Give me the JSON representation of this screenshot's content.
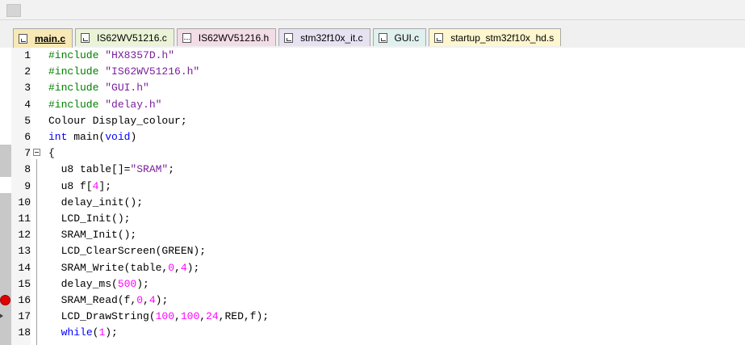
{
  "tabs": [
    {
      "label": "main.c",
      "bg": "#f7e8b5",
      "active": true,
      "icon": "c-file-icon"
    },
    {
      "label": "IS62WV51216.c",
      "bg": "#eaf3d6",
      "active": false,
      "icon": "c-file-icon"
    },
    {
      "label": "IS62WV51216.h",
      "bg": "#f2dce6",
      "active": false,
      "icon": "h-file-icon"
    },
    {
      "label": "stm32f10x_it.c",
      "bg": "#e6e2f2",
      "active": false,
      "icon": "c-file-icon"
    },
    {
      "label": "GUI.c",
      "bg": "#dff0ee",
      "active": false,
      "icon": "c-file-icon"
    },
    {
      "label": "startup_stm32f10x_hd.s",
      "bg": "#fdf6cf",
      "active": false,
      "icon": "s-file-icon"
    }
  ],
  "lines": [
    {
      "n": "1",
      "parts": [
        [
          "pp",
          "#include "
        ],
        [
          "str",
          "\"HX8357D.h\""
        ]
      ]
    },
    {
      "n": "2",
      "parts": [
        [
          "pp",
          "#include "
        ],
        [
          "str",
          "\"IS62WV51216.h\""
        ]
      ]
    },
    {
      "n": "3",
      "parts": [
        [
          "pp",
          "#include "
        ],
        [
          "str",
          "\"GUI.h\""
        ]
      ]
    },
    {
      "n": "4",
      "parts": [
        [
          "pp",
          "#include "
        ],
        [
          "str",
          "\"delay.h\""
        ]
      ]
    },
    {
      "n": "5",
      "parts": [
        [
          "",
          "Colour Display_colour;"
        ]
      ]
    },
    {
      "n": "6",
      "parts": [
        [
          "kw",
          "int"
        ],
        [
          "",
          " main("
        ],
        [
          "kw",
          "void"
        ],
        [
          "",
          ")"
        ]
      ]
    },
    {
      "n": "7",
      "parts": [
        [
          "",
          "{"
        ]
      ]
    },
    {
      "n": "8",
      "parts": [
        [
          "",
          "  u8 table[]="
        ],
        [
          "str",
          "\"SRAM\""
        ],
        [
          "",
          ";"
        ]
      ]
    },
    {
      "n": "9",
      "parts": [
        [
          "",
          "  u8 f["
        ],
        [
          "num",
          "4"
        ],
        [
          "",
          "];"
        ]
      ]
    },
    {
      "n": "10",
      "parts": [
        [
          "",
          "  delay_init();"
        ]
      ]
    },
    {
      "n": "11",
      "parts": [
        [
          "",
          "  LCD_Init();"
        ]
      ]
    },
    {
      "n": "12",
      "parts": [
        [
          "",
          "  SRAM_Init();"
        ]
      ]
    },
    {
      "n": "13",
      "parts": [
        [
          "",
          "  LCD_ClearScreen(GREEN);"
        ]
      ]
    },
    {
      "n": "14",
      "parts": [
        [
          "",
          "  SRAM_Write(table,"
        ],
        [
          "num",
          "0"
        ],
        [
          "",
          ","
        ],
        [
          "num",
          "4"
        ],
        [
          "",
          ");"
        ]
      ]
    },
    {
      "n": "15",
      "parts": [
        [
          "",
          "  delay_ms("
        ],
        [
          "num",
          "500"
        ],
        [
          "",
          ");"
        ]
      ]
    },
    {
      "n": "16",
      "parts": [
        [
          "",
          "  SRAM_Read(f,"
        ],
        [
          "num",
          "0"
        ],
        [
          "",
          ","
        ],
        [
          "num",
          "4"
        ],
        [
          "",
          ");"
        ]
      ]
    },
    {
      "n": "17",
      "parts": [
        [
          "",
          "  LCD_DrawString("
        ],
        [
          "num",
          "100"
        ],
        [
          "",
          ","
        ],
        [
          "num",
          "100"
        ],
        [
          "",
          ","
        ],
        [
          "num",
          "24"
        ],
        [
          "",
          ",RED,f);"
        ]
      ]
    },
    {
      "n": "18",
      "parts": [
        [
          "",
          "  "
        ],
        [
          "kw",
          "while"
        ],
        [
          "",
          "("
        ],
        [
          "num",
          "1"
        ],
        [
          "",
          ");"
        ]
      ]
    }
  ],
  "markers": {
    "breakpoint_line": "16",
    "current_line": "17",
    "fold_line": "7"
  },
  "colors": {
    "keyword": "#0000ff",
    "preprocessor": "#008000",
    "string": "#7a1f9c",
    "number": "#ff00ff",
    "breakpoint": "#e00000"
  }
}
